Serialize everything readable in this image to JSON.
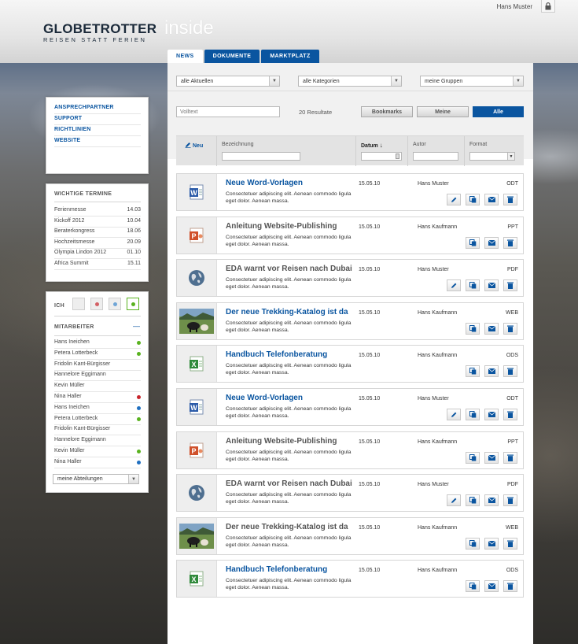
{
  "header": {
    "logo_main": "GLOBETROTTER",
    "logo_sub": "REISEN STATT FERIEN",
    "app_name": "inside",
    "user_name": "Hans Muster",
    "lock_icon": "lock-icon"
  },
  "tabs": [
    {
      "label": "NEWS",
      "active": true
    },
    {
      "label": "DOKUMENTE",
      "active": false
    },
    {
      "label": "MARKTPLATZ",
      "active": false
    }
  ],
  "filters": {
    "aktuelle": "alle Aktuellen",
    "kategorien": "alle Kategorien",
    "gruppen": "meine Gruppen"
  },
  "search": {
    "placeholder": "Volltext",
    "results": "20 Resultate",
    "bookmarks": "Bookmarks",
    "meine": "Meine",
    "alle": "Alle"
  },
  "columns": {
    "neu": "Neu",
    "bezeichnung": "Bezeichnung",
    "datum": "Datum",
    "autor": "Autor",
    "format": "Format"
  },
  "rows": [
    {
      "icon": "word-icon",
      "title": "Neue Word-Vorlagen",
      "link": true,
      "desc": "Consectetuer adipiscing elit. Aenean commodo ligula eget dolor. Aenean massa.",
      "date": "15.05.10",
      "author": "Hans Muster",
      "format": "ODT",
      "edit": true
    },
    {
      "icon": "powerpoint-icon",
      "title": "Anleitung Website-Publishing",
      "link": false,
      "desc": "Consectetuer adipiscing elit. Aenean commodo ligula eget dolor. Aenean massa.",
      "date": "15.05.10",
      "author": "Hans Kaufmann",
      "format": "PPT",
      "edit": false
    },
    {
      "icon": "globe-icon",
      "title": "EDA warnt vor Reisen nach Dubai",
      "link": false,
      "desc": "Consectetuer adipiscing elit. Aenean commodo ligula eget dolor. Aenean massa.",
      "date": "15.05.10",
      "author": "Hans Muster",
      "format": "PDF",
      "edit": true
    },
    {
      "icon": "photo-thumbnail",
      "title": "Der neue Trekking-Katalog ist da",
      "link": true,
      "desc": "Consectetuer adipiscing elit. Aenean commodo ligula eget dolor. Aenean massa.",
      "date": "15.05.10",
      "author": "Hans Kaufmann",
      "format": "WEB",
      "edit": false
    },
    {
      "icon": "excel-icon",
      "title": "Handbuch Telefonberatung",
      "link": true,
      "desc": "Consectetuer adipiscing elit. Aenean commodo ligula eget dolor. Aenean massa.",
      "date": "15.05.10",
      "author": "Hans Kaufmann",
      "format": "ODS",
      "edit": false
    },
    {
      "icon": "word-icon",
      "title": "Neue Word-Vorlagen",
      "link": true,
      "desc": "Consectetuer adipiscing elit. Aenean commodo ligula eget dolor. Aenean massa.",
      "date": "15.05.10",
      "author": "Hans Muster",
      "format": "ODT",
      "edit": true
    },
    {
      "icon": "powerpoint-icon",
      "title": "Anleitung Website-Publishing",
      "link": false,
      "desc": "Consectetuer adipiscing elit. Aenean commodo ligula eget dolor. Aenean massa.",
      "date": "15.05.10",
      "author": "Hans Kaufmann",
      "format": "PPT",
      "edit": false
    },
    {
      "icon": "globe-icon",
      "title": "EDA warnt vor Reisen nach Dubai",
      "link": false,
      "desc": "Consectetuer adipiscing elit. Aenean commodo ligula eget dolor. Aenean massa.",
      "date": "15.05.10",
      "author": "Hans Muster",
      "format": "PDF",
      "edit": true
    },
    {
      "icon": "photo-thumbnail",
      "title": "Der neue Trekking-Katalog ist da",
      "link": false,
      "desc": "Consectetuer adipiscing elit. Aenean commodo ligula eget dolor. Aenean massa.",
      "date": "15.05.10",
      "author": "Hans Kaufmann",
      "format": "WEB",
      "edit": false
    },
    {
      "icon": "excel-icon",
      "title": "Handbuch Telefonberatung",
      "link": true,
      "desc": "Consectetuer adipiscing elit. Aenean commodo ligula eget dolor. Aenean massa.",
      "date": "15.05.10",
      "author": "Hans Kaufmann",
      "format": "ODS",
      "edit": false
    }
  ],
  "nav": [
    "ANSPRECHPARTNER",
    "SUPPORT",
    "RICHTLINIEN",
    "WEBSITE"
  ],
  "termine": {
    "heading": "WICHTIGE TERMINE",
    "items": [
      {
        "name": "Ferienmesse",
        "date": "14.03"
      },
      {
        "name": "Kickoff 2012",
        "date": "10.04"
      },
      {
        "name": "Beraterkongress",
        "date": "18.06"
      },
      {
        "name": "Hochzeitsmesse",
        "date": "20.09"
      },
      {
        "name": "Olympia Lindon 2012",
        "date": "01.10"
      },
      {
        "name": "Africa Summit",
        "date": "15.11"
      }
    ]
  },
  "team": {
    "ich_label": "ICH",
    "heading": "MITARBEITER",
    "collapse_symbol": "—",
    "members": [
      {
        "name": "Hans Ineichen",
        "status": "green"
      },
      {
        "name": "Petera Lotterbeck",
        "status": "green"
      },
      {
        "name": "Fridolin Kant-Bürgisser",
        "status": ""
      },
      {
        "name": "Hannelore Eggimann",
        "status": ""
      },
      {
        "name": "Kevin Müller",
        "status": ""
      },
      {
        "name": "Nina Haller",
        "status": "red"
      },
      {
        "name": "Hans Ineichen",
        "status": "blue"
      },
      {
        "name": "Petera Lotterbeck",
        "status": "green"
      },
      {
        "name": "Fridolin Kant-Bürgisser",
        "status": ""
      },
      {
        "name": "Hannelore Eggimann",
        "status": ""
      },
      {
        "name": "Kevin Müller",
        "status": "green"
      },
      {
        "name": "Nina Haller",
        "status": "blue"
      }
    ],
    "department_select": "meine Abteilungen"
  },
  "colors": {
    "brand_blue": "#0a55a0",
    "status_green": "#59b21f",
    "status_red": "#c8242b",
    "status_blue": "#1f6fc0"
  }
}
